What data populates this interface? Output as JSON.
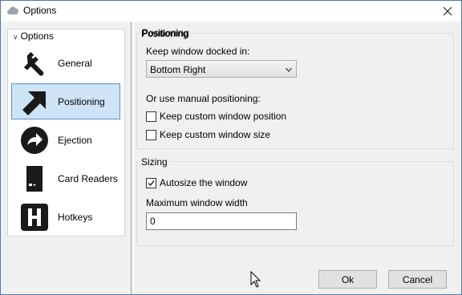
{
  "window": {
    "title": "Options"
  },
  "sidebar": {
    "header": "Options",
    "items": [
      {
        "label": "General",
        "icon": "wrench-icon"
      },
      {
        "label": "Positioning",
        "icon": "arrow-icon",
        "selected": true
      },
      {
        "label": "Ejection",
        "icon": "eject-icon"
      },
      {
        "label": "Card Readers",
        "icon": "sd-card-icon"
      },
      {
        "label": "Hotkeys",
        "icon": "hotkey-icon"
      }
    ]
  },
  "positioning": {
    "group_title": "Positioning",
    "dock_label": "Keep window docked in:",
    "dock_value": "Bottom Right",
    "manual_label": "Or use manual positioning:",
    "custom_position_label": "Keep custom window position",
    "custom_position_checked": false,
    "custom_size_label": "Keep custom window size",
    "custom_size_checked": false
  },
  "sizing": {
    "group_title": "Sizing",
    "autosize_label": "Autosize the window",
    "autosize_checked": true,
    "max_width_label": "Maximum window width",
    "max_width_value": "0"
  },
  "buttons": {
    "ok": "Ok",
    "cancel": "Cancel"
  },
  "colors": {
    "selection_bg": "#cde4f7",
    "selection_border": "#5a8fcf",
    "window_border": "#4a7bb7"
  }
}
